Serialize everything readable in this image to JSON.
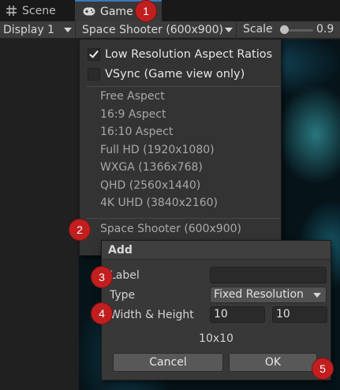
{
  "tabs": [
    {
      "label": "Scene",
      "icon": "grid-icon"
    },
    {
      "label": "Game",
      "icon": "gamepad-icon",
      "active": true
    }
  ],
  "toolbar": {
    "display_label": "Display 1",
    "resolution_label": "Space Shooter (600x900)",
    "scale_label": "Scale",
    "scale_value": "0.9"
  },
  "menu": {
    "checkboxes": [
      {
        "label": "Low Resolution Aspect Ratios",
        "checked": true
      },
      {
        "label": "VSync (Game view only)",
        "checked": false
      }
    ],
    "items": [
      "Free Aspect",
      "16:9 Aspect",
      "16:10 Aspect",
      "Full HD (1920x1080)",
      "WXGA (1366x768)",
      "QHD (2560x1440)",
      "4K UHD (3840x2160)"
    ],
    "custom_items": [
      "Space Shooter (600x900)"
    ]
  },
  "dialog": {
    "title": "Add",
    "label_label": "Label",
    "label_value": "",
    "type_label": "Type",
    "type_value": "Fixed Resolution",
    "size_label": "Width & Height",
    "width_value": "10",
    "height_value": "10",
    "summary": "10x10",
    "cancel_label": "Cancel",
    "ok_label": "OK"
  },
  "markers": [
    "1",
    "2",
    "3",
    "4",
    "5"
  ],
  "colors": {
    "accent": "#3a79bb",
    "marker": "#c11f1f",
    "game_background": "#06141a"
  }
}
